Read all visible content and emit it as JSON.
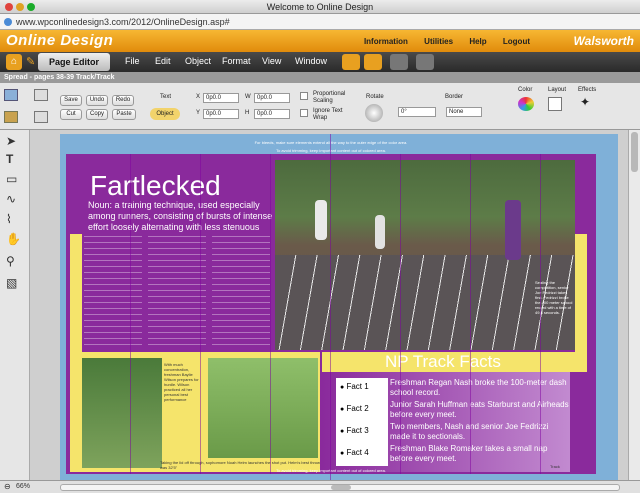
{
  "browser": {
    "title": "Welcome to Online Design",
    "url": "www.wpconlinedesign3.com/2012/OnlineDesign.asp#"
  },
  "brand": {
    "logo": "Online Design",
    "links": [
      "Information",
      "Utilities",
      "Help",
      "Logout"
    ],
    "partner": "Walsworth"
  },
  "menubar": {
    "editor": "Page Editor",
    "items": [
      "File",
      "Edit",
      "Object",
      "Format",
      "View",
      "Window"
    ]
  },
  "spread": {
    "label": "Spread - pages 38-39 Track/Track"
  },
  "toolbar": {
    "buttons": [
      "Save",
      "Undo",
      "Redo",
      "Cut",
      "Copy",
      "Paste"
    ],
    "text_label": "Text",
    "object_label": "Object",
    "x_label": "X",
    "x_value": "0p0.0",
    "w_label": "W",
    "w_value": "0p0.0",
    "y_label": "Y",
    "y_value": "0p0.0",
    "h_label": "H",
    "h_value": "0p0.0",
    "proportional": "Proportional Scaling",
    "ignore_wrap": "Ignore Text Wrap",
    "rotate_label": "Rotate",
    "rotate_value": "0°",
    "border_label": "Border",
    "border_value": "None",
    "color_label": "Color",
    "layout_label": "Layout",
    "effects_label": "Effects"
  },
  "page": {
    "guide_top": "For bleeds, make sure elements extend all the way to the outer edge of the color area.",
    "guide_trim": "To avoid trimming, keep important content out of colored area.",
    "headline": "Fartlecked",
    "definition": "Noun: a training technique, used especially among runners, consisting of bursts of intense effort loosely alternating with less stenuous activity",
    "facts_title": "NP Track Facts",
    "facts": [
      {
        "label": "Fact 1",
        "text": "Freshman Regan Nash broke the 100-meter dash school record."
      },
      {
        "label": "Fact 2",
        "text": "Junior Sarah Huffman eats Starburst and Airheads before every meet."
      },
      {
        "label": "Fact 3",
        "text": "Two members, Nash and senior Joe Fedrizzi made it to sectionals."
      },
      {
        "label": "Fact 4",
        "text": "Freshman Blake Romaker takes a small nap before every meet."
      }
    ],
    "caption_right": "Sealing the competition, senior Joe Fedrizzi takes first. Fedrizzi broke the 400 meter school record with a time of 49.8 seconds.",
    "caption_hurdle": "With much concentration, freshman Baylie Wilson prepares for hurdle. Wilson practiced all her personal best performance",
    "caption_bottom": "Taking the lid off through, sophomore Noah Helm launches the shot put. Helm's best throw was 32'5\"",
    "folio": "Track"
  },
  "status": {
    "zoom": "66%"
  }
}
